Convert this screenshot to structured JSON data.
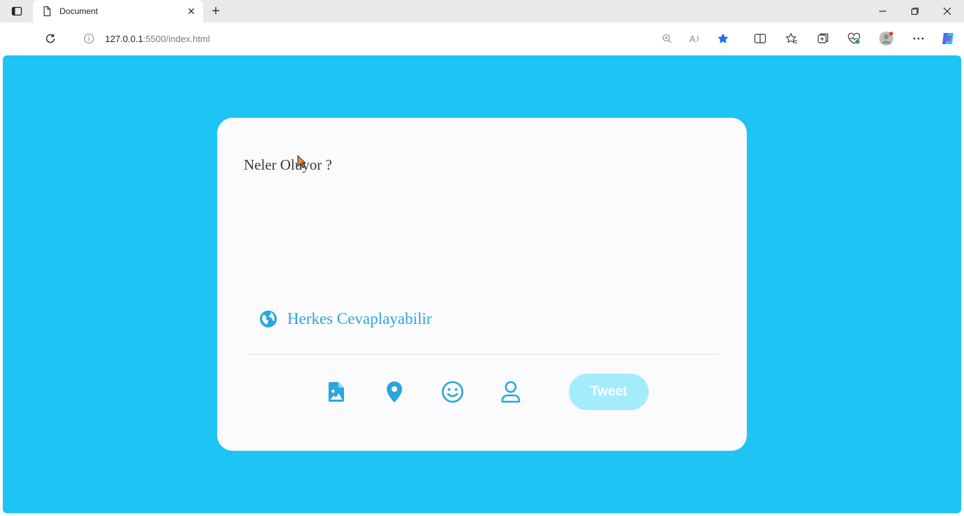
{
  "browser": {
    "tab": {
      "title": "Document"
    },
    "address": {
      "host": "127.0.0.1",
      "rest": ":5500/index.html"
    }
  },
  "page": {
    "background_color": "#1dc4f4",
    "composer": {
      "placeholder": "Neler Oluyor ?",
      "reply_setting": {
        "icon": "globe-icon",
        "label": "Herkes Cevaplayabilir"
      },
      "actions": [
        {
          "name": "image-icon"
        },
        {
          "name": "location-icon"
        },
        {
          "name": "emoji-icon"
        },
        {
          "name": "user-icon"
        }
      ],
      "tweet_label": "Tweet",
      "accent_color": "#1da1f2"
    }
  }
}
